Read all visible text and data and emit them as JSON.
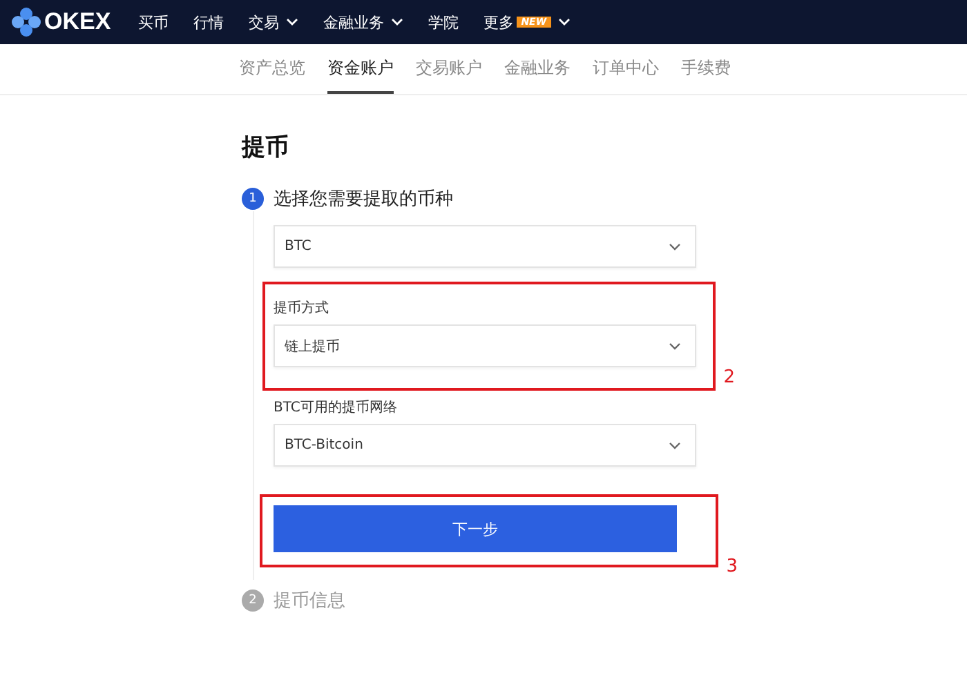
{
  "nav": {
    "logo": "OKEX",
    "items": [
      {
        "label": "买币",
        "dropdown": false
      },
      {
        "label": "行情",
        "dropdown": false
      },
      {
        "label": "交易",
        "dropdown": true
      },
      {
        "label": "金融业务",
        "dropdown": true
      },
      {
        "label": "学院",
        "dropdown": false
      },
      {
        "label": "更多",
        "dropdown": true,
        "badge": "NEW"
      }
    ]
  },
  "subnav": [
    {
      "label": "资产总览",
      "selected": false
    },
    {
      "label": "资金账户",
      "selected": true
    },
    {
      "label": "交易账户",
      "selected": false
    },
    {
      "label": "金融业务",
      "selected": false
    },
    {
      "label": "订单中心",
      "selected": false
    },
    {
      "label": "手续费",
      "selected": false
    }
  ],
  "title": "提币",
  "steps": [
    {
      "number": "1",
      "label": "选择您需要提取的币种",
      "active": true
    },
    {
      "number": "2",
      "label": "提币信息",
      "active": false
    }
  ],
  "fields": [
    {
      "value": "BTC"
    },
    {
      "label": "提币方式",
      "value": "链上提币",
      "annotation": "2"
    },
    {
      "label": "BTC可用的提币网络",
      "value": "BTC-Bitcoin"
    }
  ],
  "next_button": {
    "label": "下一步",
    "annotation": "3"
  }
}
